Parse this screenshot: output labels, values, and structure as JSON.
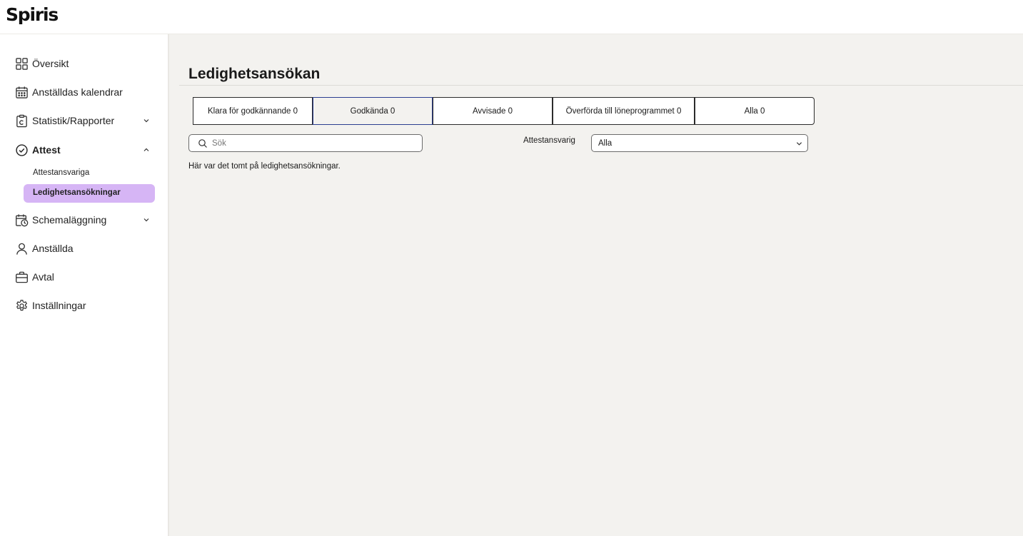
{
  "header": {
    "logo": "Spiris"
  },
  "sidebar": {
    "items": [
      {
        "label": "Översikt",
        "icon": "grid-icon"
      },
      {
        "label": "Anställdas kalendrar",
        "icon": "calendar-icon"
      },
      {
        "label": "Statistik/Rapporter",
        "icon": "report-icon",
        "expanded": false
      },
      {
        "label": "Attest",
        "icon": "check-circle-icon",
        "expanded": true
      },
      {
        "label": "Schemaläggning",
        "icon": "calendar-clock-icon",
        "expanded": false
      },
      {
        "label": "Anställda",
        "icon": "person-icon"
      },
      {
        "label": "Avtal",
        "icon": "briefcase-icon"
      },
      {
        "label": "Inställningar",
        "icon": "gear-icon"
      }
    ],
    "attest_sub": [
      {
        "label": "Attestansvariga",
        "active": false
      },
      {
        "label": "Ledighetsansökningar",
        "active": true
      }
    ],
    "active_color": "#d6b5f5"
  },
  "main": {
    "title": "Ledighetsansökan",
    "tabs": [
      {
        "label": "Klara för godkännande 0",
        "active": false
      },
      {
        "label": "Godkända 0",
        "active": true
      },
      {
        "label": "Avvisade 0",
        "active": false
      },
      {
        "label": "Överförda till löneprogrammet 0",
        "active": false
      },
      {
        "label": "Alla 0",
        "active": false
      }
    ],
    "search": {
      "placeholder": "Sök",
      "value": ""
    },
    "filter": {
      "label": "Attestansvarig",
      "selected": "Alla"
    },
    "empty_message": "Här var det tomt på ledighetsansökningar."
  }
}
